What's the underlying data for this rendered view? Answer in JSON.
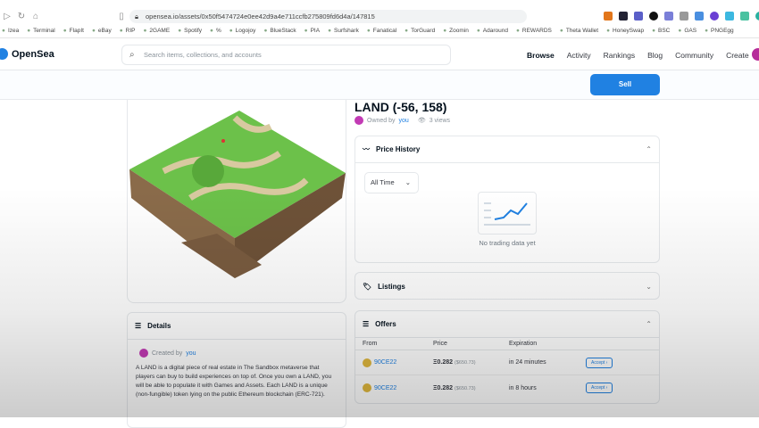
{
  "browser": {
    "url": "opensea.io/assets/0x50f5474724e0ee42d9a4e711ccfb275809fd6d4a/147815",
    "bookmarks": [
      "Izea",
      "Terminal",
      "FlapIt",
      "eBay",
      "RIP",
      "2GAME",
      "Spotify",
      "%",
      "Logojoy",
      "BlueStack",
      "PIA",
      "Surfshark",
      "Fanatical",
      "TorGuard",
      "Zoomin",
      "Adaround",
      "REWARDS",
      "Theta Wallet",
      "HoneySwap",
      "BSC",
      "GAS",
      "PNGEgg"
    ]
  },
  "nav": {
    "logo": "OpenSea",
    "search_placeholder": "Search items, collections, and accounts",
    "items": [
      "Browse",
      "Activity",
      "Rankings",
      "Blog",
      "Community",
      "Create"
    ]
  },
  "action": {
    "sell": "Sell"
  },
  "asset": {
    "title": "LAND (-56, 158)",
    "owned_prefix": "Owned by",
    "owner": "you",
    "views": "3 views"
  },
  "price_history": {
    "title": "Price History",
    "filter": "All Time",
    "empty": "No trading data yet"
  },
  "listings": {
    "title": "Listings"
  },
  "offers": {
    "title": "Offers",
    "headers": [
      "From",
      "Price",
      "Expiration"
    ],
    "rows": [
      {
        "from": "90CE22",
        "price": "0.282",
        "usd": "($650.73)",
        "expiration": "in 24 minutes",
        "action": "Accept"
      },
      {
        "from": "90CE22",
        "price": "0.282",
        "usd": "($650.73)",
        "expiration": "in 8 hours",
        "action": "Accept"
      }
    ]
  },
  "details": {
    "title": "Details",
    "created_prefix": "Created by",
    "creator": "you",
    "description": "A LAND is a digital piece of real estate in The Sandbox metaverse that players can buy to build experiences on top of. Once you own a LAND, you will be able to populate it with Games and Assets. Each LAND is a unique (non-fungible) token lying on the public Ethereum blockchain (ERC-721)."
  },
  "colors": {
    "accent": "#2081e2",
    "grass": "#6cc14a",
    "dirt": "#8a6b4a"
  }
}
